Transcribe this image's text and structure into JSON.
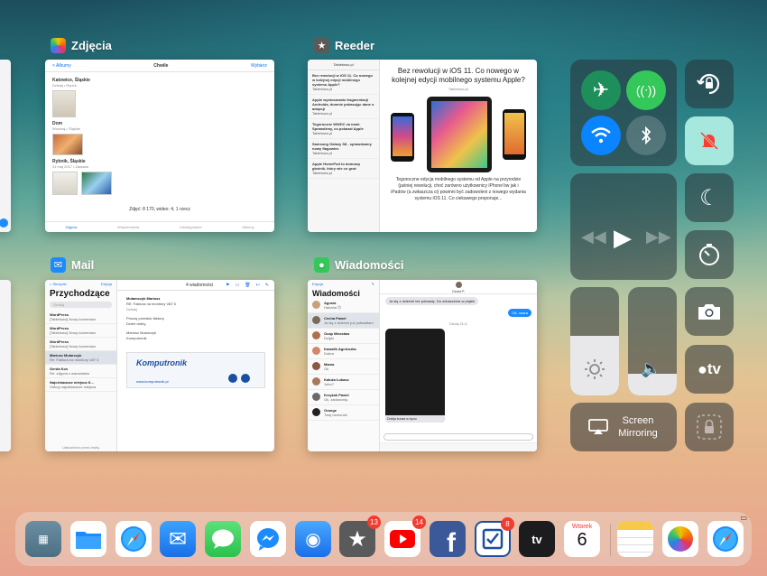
{
  "switcher": {
    "photos": {
      "label": "Zdjęcia",
      "nav_back": "< Albumy",
      "nav_title": "Chwile",
      "nav_select": "Wybierz",
      "sections": [
        {
          "title": "Katowice, Śląskie",
          "sub": "Dzisiaj • Rynek"
        },
        {
          "title": "Dom",
          "sub": "Wczoraj • Śląskie"
        },
        {
          "title": "Rybnik, Śląskie",
          "sub": "31 maj 2017 • Zawada"
        }
      ],
      "summary": "Zdjęć: 8 170, wideo: 4, 1 rzecz",
      "tabs": [
        "Zdjęcia",
        "Wspomnienia",
        "Udostępniane",
        "Albumy"
      ]
    },
    "reeder": {
      "label": "Reeder",
      "feed_title": "Tabletowo.pl",
      "items": [
        {
          "title": "Bez rewolucji w iOS 11. Co nowego w kolejnej edycji mobilnego systemu Apple?",
          "source": "Tabletowo.pl"
        },
        {
          "title": "Apple wystosowało fragmentacji Androida, dumnie pokazując dane o adopcji",
          "source": "Tabletowo.pl"
        },
        {
          "title": "Tegoroczne WWDC za nami. Sprawdźmy, co pokazał Apple",
          "source": "Tabletowo.pl"
        },
        {
          "title": "Samsung Galaxy S8 - sprawdzamy nowy flagowiec",
          "source": "Tabletowo.pl"
        },
        {
          "title": "Apple HomePod to domowy głośnik, który wie co grać",
          "source": "Tabletowo.pl"
        }
      ],
      "article_title": "Bez rewolucji w iOS 11. Co nowego w kolejnej edycji mobilnego systemu Apple?",
      "article_meta": "Tabletowo.pl",
      "article_text": "Tegoroczne edycja mobilnego systemu od Apple na przyrodzie (jaśniej rewolucji, choć zarówno użytkownicy iPhone'ów jak i iPadów (a zwłaszcza ci) powinni być zadowoleni z nowego wydania systemu iOS 11. Co ciekawego proponuje..."
    },
    "mail": {
      "label": "Mail",
      "back": "< Skrzynki",
      "edit": "Edycja",
      "title": "Przychodzące",
      "search": "Szukaj",
      "counter": "4 wiadomości",
      "items": [
        {
          "from": "WordPress",
          "subject": "[Tabletowo] Nowy komentarz",
          "preview": "Czytelnik dodał nowy komentarz do wpisu Tegoroczne WWDC za nami..."
        },
        {
          "from": "WordPress",
          "subject": "[Tabletowo] Nowy komentarz",
          "preview": "Czytelnik dodał nowy komentarz..."
        },
        {
          "from": "WordPress",
          "subject": "[Tabletowo] Nowy komentarz",
          "preview": "Czytelnik dodał nowy komentarz..."
        },
        {
          "from": "Mariusz Mularczyk",
          "subject": "Re: Faktura na monitory VAT 5",
          "preview": "Proszę o przesłanie faktury"
        },
        {
          "from": "Gerda Kos",
          "subject": "Re: zdjęcia z warsztatów",
          "preview": "Przesyłam zdjęcia z warsztatów"
        },
        {
          "from": "Najciekawsze miejsca K...",
          "subject": "Odkryj najciekawsze miejsca",
          "preview": "Zobacz jakie miejsca warto odwiedzić"
        }
      ],
      "detail_from": "Mulamczyk Mariusz",
      "detail_subject": "RE: Faktura na monitory VAT 5",
      "detail_date": "Dzisiaj",
      "detail_body": [
        "Proszę przesłać fakturę",
        "Dzień dobry,",
        "Mariusz Mularczyk",
        "Komputronik"
      ],
      "footer": "Uaktualniono przed chwilą",
      "banner_brand": "Komputronik",
      "banner_url": "www.komputronik.pl"
    },
    "messages": {
      "label": "Wiadomości",
      "edit": "Edycja",
      "title": "Wiadomości",
      "contact": "Cecha P.",
      "conversations": [
        {
          "name": "Agusia",
          "preview": "Hahaha 😊",
          "time": "16:42"
        },
        {
          "name": "Cecha Paweł",
          "preview": "Ja się z dziećmi już pobawiłam",
          "time": "15:06"
        },
        {
          "name": "Ocap Mirosław",
          "preview": "Dzięki",
          "time": "Wczoraj"
        },
        {
          "name": "Kawalik Agnieszka",
          "preview": "Dobra",
          "time": "Wczoraj"
        },
        {
          "name": "Mama",
          "preview": "Ok",
          "time": "niedziela"
        },
        {
          "name": "Kałuża Łukasz",
          "preview": "Jutro?",
          "time": "niedziela"
        },
        {
          "name": "Krzyżak Paweł",
          "preview": "Ok, zadzwonię",
          "time": "piątek"
        },
        {
          "name": "Orange",
          "preview": "Twój rachunek",
          "time": "piątek"
        }
      ],
      "incoming": "Ja się z dziećmi też pobawię. Do zobaczenia w piątek",
      "outgoing": "Ok, naara",
      "date_label": "Dzisiaj 15:11",
      "image_caption": "Dobija kurwa w życiu"
    }
  },
  "control_center": {
    "screen_mirroring": "Screen Mirroring",
    "appletv": "tv",
    "brightness": 0.55,
    "volume": 0.2
  },
  "dock": {
    "calendar_day": "Wtorek",
    "calendar_date": "6",
    "badges": {
      "reeder": "13",
      "youtube": "14",
      "omnifocus": "8"
    }
  },
  "colors": {
    "airplane": "#1e8f5a",
    "cellular": "#34c759",
    "wifi": "#0a84ff",
    "dnd": "#a6e8de"
  }
}
